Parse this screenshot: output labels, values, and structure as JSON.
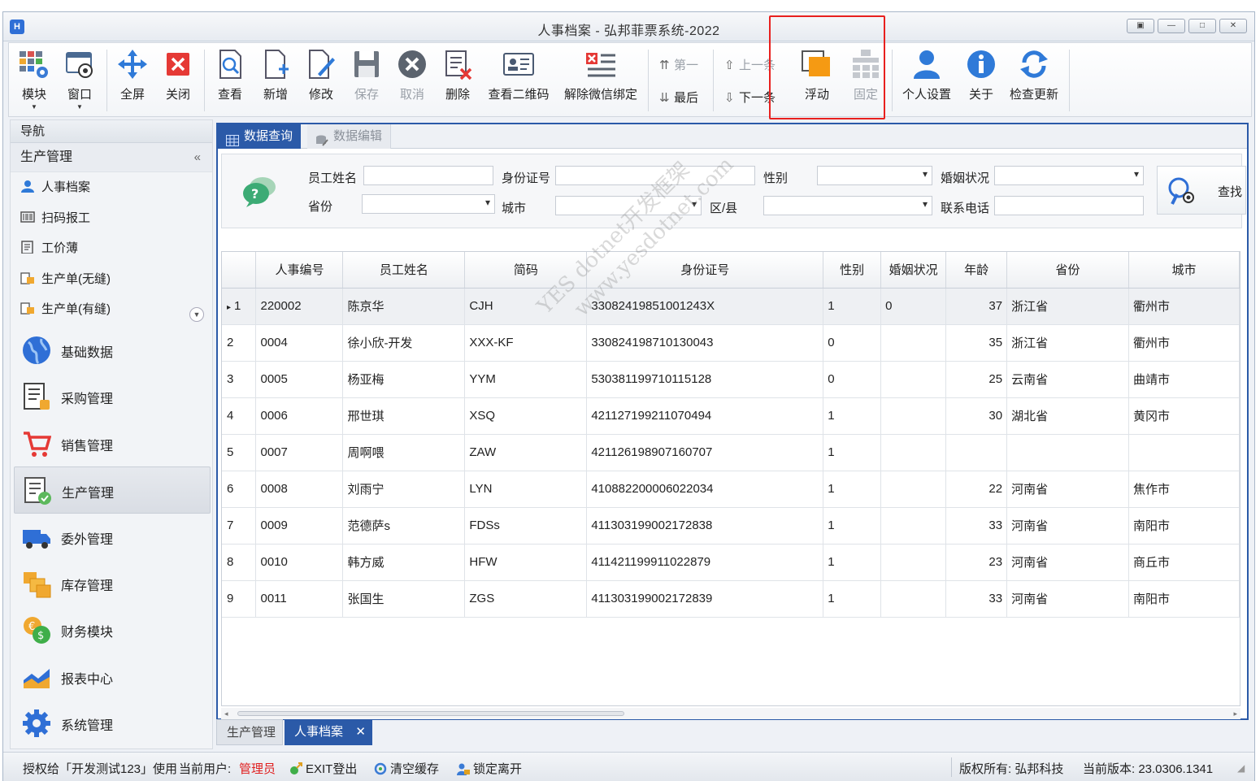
{
  "window": {
    "title": "人事档案 - 弘邦菲票系统-2022",
    "app_logo": "H"
  },
  "toolbar": {
    "module": "模块",
    "window": "窗口",
    "fullscreen": "全屏",
    "close": "关闭",
    "view": "查看",
    "add": "新增",
    "edit": "修改",
    "save": "保存",
    "cancel": "取消",
    "delete": "删除",
    "view_qrcode": "查看二维码",
    "unbind_wechat": "解除微信绑定",
    "first": "第一",
    "last": "最后",
    "prev": "上一条",
    "next": "下一条",
    "float": "浮动",
    "fixed": "固定",
    "personal_settings": "个人设置",
    "about": "关于",
    "check_update": "检查更新"
  },
  "sidebar": {
    "nav_title": "导航",
    "group_title": "生产管理",
    "collapse_glyph": "«",
    "sub_items": [
      "人事档案",
      "扫码报工",
      "工价薄",
      "生产单(无缝)",
      "生产单(有缝)"
    ],
    "modules": [
      "基础数据",
      "采购管理",
      "销售管理",
      "生产管理",
      "委外管理",
      "库存管理",
      "财务模块",
      "报表中心",
      "系统管理"
    ],
    "selected_module": "生产管理"
  },
  "tabs": {
    "query": "数据查询",
    "edit": "数据编辑"
  },
  "query": {
    "labels": {
      "name": "员工姓名",
      "id_number": "身份证号",
      "gender": "性别",
      "marital": "婚姻状况",
      "province": "省份",
      "city": "城市",
      "district": "区/县",
      "phone": "联系电话"
    },
    "values": {
      "name": "",
      "id_number": "",
      "gender": "",
      "marital": "",
      "province": "",
      "city": "",
      "district": "",
      "phone": ""
    },
    "search_button": "查找"
  },
  "grid": {
    "columns": [
      "人事编号",
      "员工姓名",
      "简码",
      "身份证号",
      "性别",
      "婚姻状况",
      "年龄",
      "省份",
      "城市"
    ],
    "current_row_marker": "▸",
    "rows": [
      [
        "1",
        "220002",
        "陈京华",
        "CJH",
        "33082419851001243X",
        "1",
        "0",
        "37",
        "浙江省",
        "衢州市"
      ],
      [
        "2",
        "0004",
        "徐小欣-开发",
        "XXX-KF",
        "330824198710130043",
        "0",
        "",
        "35",
        "浙江省",
        "衢州市"
      ],
      [
        "3",
        "0005",
        "杨亚梅",
        "YYM",
        "530381199710115128",
        "0",
        "",
        "25",
        "云南省",
        "曲靖市"
      ],
      [
        "4",
        "0006",
        "邢世琪",
        "XSQ",
        "421127199211070494",
        "1",
        "",
        "30",
        "湖北省",
        "黄冈市"
      ],
      [
        "5",
        "0007",
        "周啊喂",
        "ZAW",
        "421126198907160707",
        "1",
        "",
        "",
        "",
        ""
      ],
      [
        "6",
        "0008",
        "刘雨宁",
        "LYN",
        "410882200006022034",
        "1",
        "",
        "22",
        "河南省",
        "焦作市"
      ],
      [
        "7",
        "0009",
        "范德萨s",
        "FDSs",
        "411303199002172838",
        "1",
        "",
        "33",
        "河南省",
        "南阳市"
      ],
      [
        "8",
        "0010",
        "韩方威",
        "HFW",
        "411421199911022879",
        "1",
        "",
        "23",
        "河南省",
        "商丘市"
      ],
      [
        "9",
        "0011",
        "张国生",
        "ZGS",
        "411303199002172839",
        "1",
        "",
        "33",
        "河南省",
        "南阳市"
      ]
    ]
  },
  "watermark": {
    "line1": "YES dotnet开发框架",
    "line2": "www.yesdotnet.com"
  },
  "doc_tabs": {
    "inactive": "生产管理",
    "active": "人事档案",
    "close": "✕"
  },
  "status": {
    "licensed": "授权给「开发测试123」使用",
    "current_user_label": "当前用户:",
    "current_user": "管理员",
    "exit": "EXIT登出",
    "clear_cache": "清空缓存",
    "lock": "锁定离开",
    "copyright": "版权所有: 弘邦科技",
    "version": "当前版本: 23.0306.1341"
  },
  "colors": {
    "accent": "#2b5aa8",
    "highlight": "#e8201e",
    "user": "#e02020"
  }
}
